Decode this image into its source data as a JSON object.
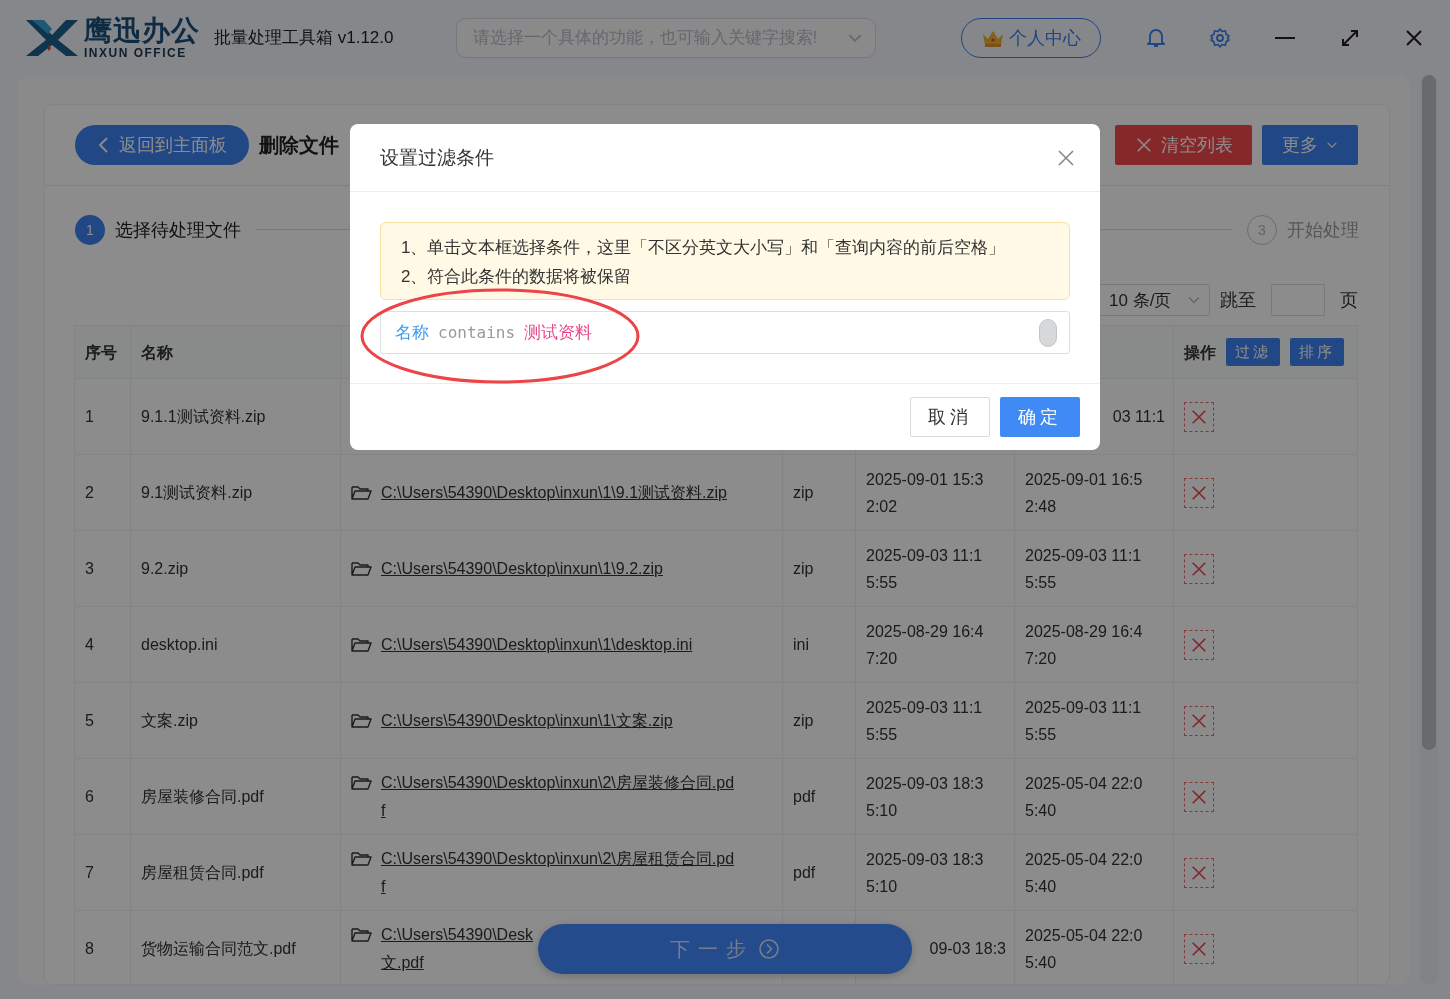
{
  "app": {
    "logo_name": "鹰迅办公",
    "logo_subtitle": "INXUN OFFICE",
    "title": "批量处理工具箱 v1.12.0"
  },
  "search": {
    "placeholder": "请选择一个具体的功能，也可输入关键字搜索!"
  },
  "account_button": "个人中心",
  "toolbar": {
    "back_button": "返回到主面板",
    "page_title": "删除文件",
    "buttons": [
      {
        "label": "清空列表",
        "kind": "danger"
      },
      {
        "label": "更多",
        "kind": "dropdown"
      }
    ]
  },
  "steps": [
    {
      "number": "1",
      "label": "选择待处理文件",
      "selected": true
    },
    {
      "number": "3",
      "label": "开始处理",
      "selected": false
    }
  ],
  "pagination": {
    "page_size": "10 条/页",
    "jump_label": "跳至",
    "page_suffix": "页"
  },
  "table": {
    "header": {
      "index": "序号",
      "name": "名称",
      "actions": "操作",
      "action_buttons": [
        "过滤",
        "排序"
      ]
    },
    "rows": [
      {
        "index": "1",
        "name": "9.1.1测试资料.zip",
        "modified_clipped": [
          "03 11:1"
        ]
      },
      {
        "index": "2",
        "name": "9.1测试资料.zip",
        "path": [
          "C:\\Users\\54390\\Desktop\\inxun\\1\\9.1测试资料.zip"
        ],
        "type": "zip",
        "created": [
          "2025-09-01 15:3",
          "2:02"
        ],
        "modified": [
          "2025-09-01 16:5",
          "2:48"
        ]
      },
      {
        "index": "3",
        "name": "9.2.zip",
        "path": [
          "C:\\Users\\54390\\Desktop\\inxun\\1\\9.2.zip"
        ],
        "type": "zip",
        "created": [
          "2025-09-03 11:1",
          "5:55"
        ],
        "modified": [
          "2025-09-03 11:1",
          "5:55"
        ]
      },
      {
        "index": "4",
        "name": "desktop.ini",
        "path": [
          "C:\\Users\\54390\\Desktop\\inxun\\1\\desktop.ini"
        ],
        "type": "ini",
        "created": [
          "2025-08-29 16:4",
          "7:20"
        ],
        "modified": [
          "2025-08-29 16:4",
          "7:20"
        ]
      },
      {
        "index": "5",
        "name": "文案.zip",
        "path": [
          "C:\\Users\\54390\\Desktop\\inxun\\1\\文案.zip"
        ],
        "type": "zip",
        "created": [
          "2025-09-03 11:1",
          "5:55"
        ],
        "modified": [
          "2025-09-03 11:1",
          "5:55"
        ]
      },
      {
        "index": "6",
        "name": "房屋装修合同.pdf",
        "path": [
          "C:\\Users\\54390\\Desktop\\inxun\\2\\房屋装修合同.pd",
          "f"
        ],
        "type": "pdf",
        "created": [
          "2025-09-03 18:3",
          "5:10"
        ],
        "modified": [
          "2025-05-04 22:0",
          "5:40"
        ]
      },
      {
        "index": "7",
        "name": "房屋租赁合同.pdf",
        "path": [
          "C:\\Users\\54390\\Desktop\\inxun\\2\\房屋租赁合同.pd",
          "f"
        ],
        "type": "pdf",
        "created": [
          "2025-09-03 18:3",
          "5:10"
        ],
        "modified": [
          "2025-05-04 22:0",
          "5:40"
        ]
      },
      {
        "index": "8",
        "name": "货物运输合同范文.pdf",
        "path": [
          "C:\\Users\\54390\\Desk",
          "文.pdf"
        ],
        "created_clipped": [
          "09-03 18:3"
        ],
        "modified": [
          "2025-05-04 22:0",
          "5:40"
        ]
      }
    ]
  },
  "next_button": "下一步",
  "modal": {
    "title": "设置过滤条件",
    "notice": [
      "1、单击文本框选择条件，这里「不区分英文大小写」和「查询内容的前后空格」",
      "2、符合此条件的数据将被保留"
    ],
    "filter": {
      "field": "名称",
      "operator": "contains",
      "value": "测试资料"
    },
    "buttons": [
      {
        "label": "取消",
        "kind": "secondary"
      },
      {
        "label": "确定",
        "kind": "primary"
      }
    ]
  }
}
